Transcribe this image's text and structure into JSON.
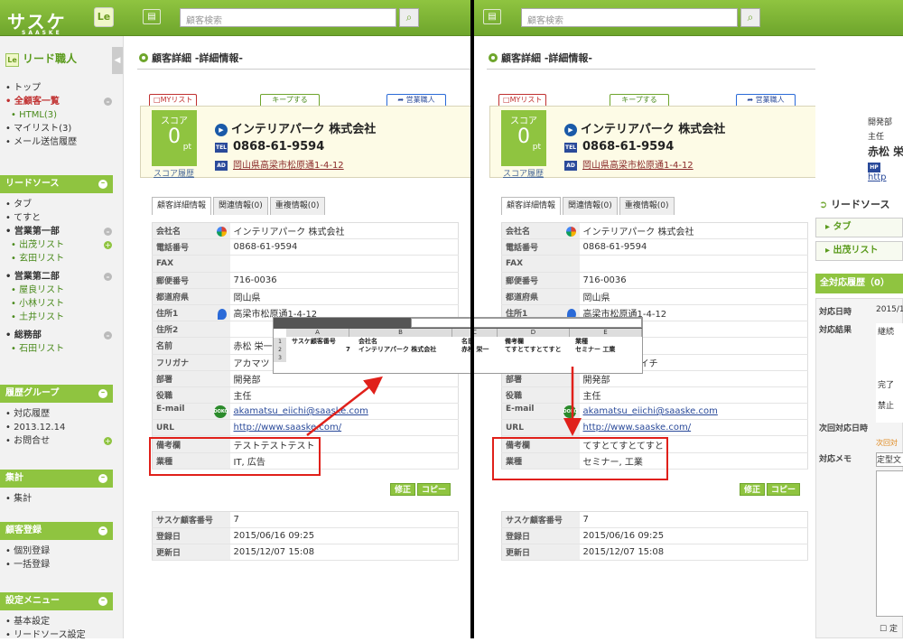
{
  "app": {
    "logo_text": "サスケ",
    "logo_sub": "SAASKE",
    "le_label": "Le",
    "search_placeholder": "顧客検索"
  },
  "sidebar": {
    "title": "リード職人",
    "top_items": [
      "トップ",
      "全顧客一覧",
      "HTML(3)",
      "マイリスト(3)",
      "メール送信履歴"
    ],
    "lead_source": {
      "head": "リードソース",
      "items": [
        "タブ",
        "てすと",
        "営業第一部",
        "出茂リスト",
        "玄田リスト",
        "営業第二部",
        "屋良リスト",
        "小林リスト",
        "土井リスト",
        "総務部",
        "石田リスト"
      ]
    },
    "history_group": {
      "head": "履歴グループ",
      "items": [
        "対応履歴",
        "2013.12.14",
        "お問合せ"
      ]
    },
    "summary": {
      "head": "集計",
      "items": [
        "集計"
      ]
    },
    "registration": {
      "head": "顧客登録",
      "items": [
        "個別登録",
        "一括登録"
      ]
    },
    "settings": {
      "head": "設定メニュー",
      "items": [
        "基本設定",
        "リードソース設定"
      ]
    }
  },
  "panel": {
    "title": "顧客詳細 -詳細情報-",
    "tabs": {
      "mylist": "MYリスト",
      "keep": "キープする",
      "sales": "営業職人"
    },
    "score_label": "スコア",
    "score_value": "0",
    "score_unit": "pt",
    "score_link": "スコア履歴",
    "company": "インテリアパーク 株式会社",
    "tel_badge": "TEL",
    "tel": "0868-61-9594",
    "ad_badge": "AD",
    "address": "岡山県高梁市松原通1-4-12",
    "subtabs": [
      "顧客詳細情報",
      "関連情報(0)",
      "重複情報(0)"
    ],
    "fields": [
      {
        "k": "会社名",
        "v": "インテリアパーク 株式会社"
      },
      {
        "k": "電話番号",
        "v": "0868-61-9594"
      },
      {
        "k": "FAX",
        "v": ""
      },
      {
        "k": "郵便番号",
        "v": "716-0036"
      },
      {
        "k": "都道府県",
        "v": "岡山県"
      },
      {
        "k": "住所1",
        "v": "高梁市松原通1-4-12"
      },
      {
        "k": "住所2",
        "v": ""
      },
      {
        "k": "名前",
        "v": "赤松 栄一"
      },
      {
        "k": "フリガナ",
        "v": "アカマツ エイイチ"
      },
      {
        "k": "部署",
        "v": "開発部"
      },
      {
        "k": "役職",
        "v": "主任"
      },
      {
        "k": "E-mail",
        "v": "akamatsu_eiichi@saaske.com"
      },
      {
        "k": "URL",
        "v": "http://www.saaske.com/"
      }
    ],
    "left_extra": [
      {
        "k": "備考欄",
        "v": "テストテストテスト"
      },
      {
        "k": "業種",
        "v": "IT, 広告"
      }
    ],
    "right_extra": [
      {
        "k": "備考欄",
        "v": "てすとてすとてすと"
      },
      {
        "k": "業種",
        "v": "セミナー, 工業"
      }
    ],
    "edit_btn": "修正",
    "copy_btn": "コピー",
    "system": [
      {
        "k": "サスケ顧客番号",
        "v": "7"
      },
      {
        "k": "登録日",
        "v": "2015/06/16 09:25"
      },
      {
        "k": "更新日",
        "v": "2015/12/07 15:08"
      }
    ]
  },
  "excel": {
    "cols": [
      "A",
      "B",
      "C",
      "D",
      "E"
    ],
    "rows": [
      "1",
      "2",
      "3"
    ],
    "header": [
      "サスケ顧客番号",
      "会社名",
      "名前",
      "備考欄",
      "業種"
    ],
    "row2": [
      "7",
      "インテリアパーク 株式会社",
      "赤松 栄一",
      "てすとてすとてすと",
      "セミナー 工業"
    ]
  },
  "right_panel": {
    "contact_lines": [
      "開発部",
      "主任",
      "赤松 栄一",
      "http"
    ],
    "hp_badge": "HP",
    "section": "リードソース",
    "items": [
      "タブ",
      "出茂リスト"
    ],
    "history_head": "全対応履歴（0）",
    "rows": [
      {
        "k": "対応日時",
        "v": "2015/1"
      },
      {
        "k": "対応結果",
        "v": "継続"
      },
      {
        "k": "",
        "v": "完了"
      },
      {
        "k": "",
        "v": "禁止"
      },
      {
        "k": "次回対応日時",
        "v": "次回対"
      },
      {
        "k": "対応メモ",
        "v": "定型文"
      }
    ],
    "checkbox_label": "定"
  }
}
